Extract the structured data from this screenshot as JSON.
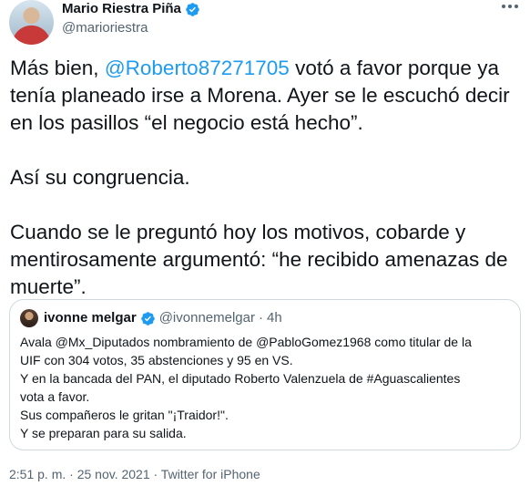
{
  "author": {
    "name": "Mario Riestra Piña",
    "handle": "@marioriestra"
  },
  "tweet": {
    "p1_before": "Más bien, ",
    "p1_mention": "@Roberto87271705",
    "p1_after": " votó a favor porque ya tenía planeado irse a Morena. Ayer se le escuchó decir en los pasillos “el negocio está hecho”.",
    "p2": "Así su congruencia.",
    "p3": "Cuando se le preguntó hoy los motivos, cobarde y mentirosamente argumentó: “he recibido amenazas de muerte”."
  },
  "quoted": {
    "name": "ivonne melgar",
    "handle": "@ivonnemelgar",
    "separator": "·",
    "time": "4h",
    "lines": [
      "Avala @Mx_Diputados nombramiento de @PabloGomez1968 como titular de la",
      "UIF con 304 votos, 35 abstenciones y 95 en VS.",
      "Y en la bancada del PAN, el diputado Roberto Valenzuela de #Aguascalientes",
      "vota a favor.",
      "Sus compañeros le gritan \"¡Traidor!\".",
      "Y se preparan para su salida."
    ]
  },
  "footer": {
    "text": "2:51 p. m. · 25 nov. 2021 · Twitter for iPhone"
  },
  "icons": {
    "verified": "verified-badge-icon",
    "more": "more-options-icon"
  },
  "colors": {
    "accent": "#1d9bf0",
    "text": "#0f1419",
    "muted": "#536471",
    "border": "#cfd9de"
  }
}
